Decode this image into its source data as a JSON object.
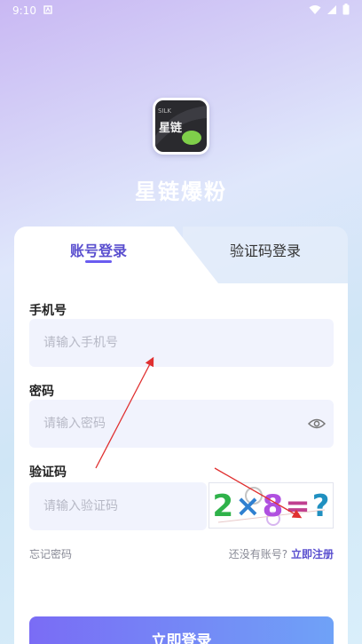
{
  "status_bar": {
    "time": "9:10"
  },
  "app": {
    "name": "星链爆粉",
    "logo_text": "星链",
    "logo_sub": "SILK"
  },
  "tabs": [
    {
      "label": "账号登录",
      "active": true
    },
    {
      "label": "验证码登录",
      "active": false
    }
  ],
  "form": {
    "phone": {
      "label": "手机号",
      "placeholder": "请输入手机号"
    },
    "password": {
      "label": "密码",
      "placeholder": "请输入密码"
    },
    "captcha": {
      "label": "验证码",
      "placeholder": "请输入验证码",
      "image_text": "2×8=?"
    }
  },
  "links": {
    "forgot": "忘记密码",
    "no_account": "还没有账号?",
    "register": "立即注册"
  },
  "login_button": "立即登录",
  "colors": {
    "accent": "#5a4fcf",
    "annotation": "#e03030"
  }
}
